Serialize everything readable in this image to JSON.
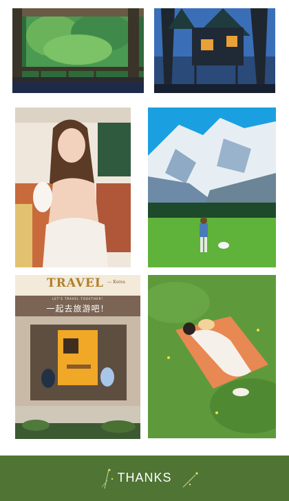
{
  "poster": {
    "title": "TRAVEL",
    "brand": "— Korea",
    "tagline": "LET'S TRAVEL TOGETHER!",
    "chinese": "一起去旅游吧！"
  },
  "footer": {
    "thanks_label": "THANKS",
    "background": "#4f7434"
  }
}
